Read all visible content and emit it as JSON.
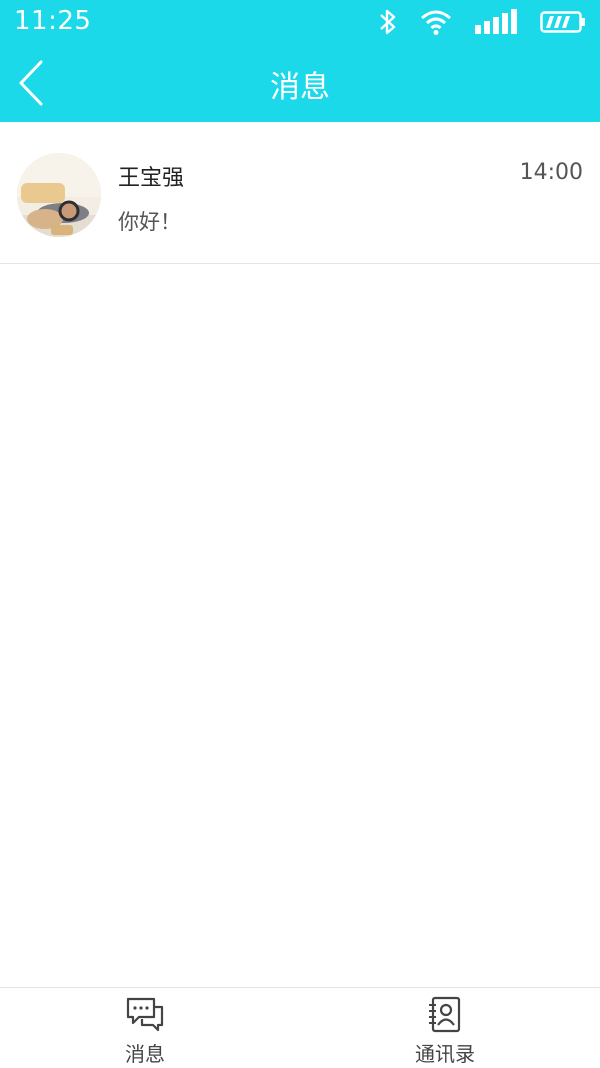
{
  "status_bar": {
    "time": "11:25"
  },
  "nav": {
    "title": "消息"
  },
  "conversations": [
    {
      "name": "王宝强",
      "preview": "你好！",
      "time": "14:00"
    }
  ],
  "tabs": [
    {
      "label": "消息",
      "icon": "chat-icon"
    },
    {
      "label": "通讯录",
      "icon": "contacts-icon"
    }
  ],
  "colors": {
    "accent": "#1cd9ea"
  }
}
